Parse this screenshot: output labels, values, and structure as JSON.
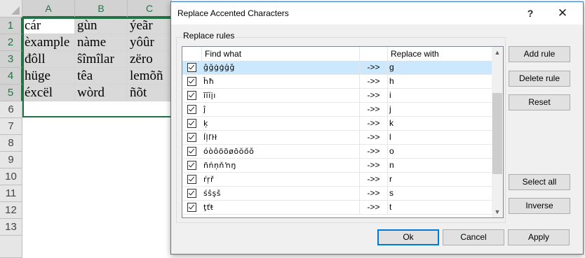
{
  "spreadsheet": {
    "columns": [
      "A",
      "B",
      "C"
    ],
    "rows": [
      "1",
      "2",
      "3",
      "4",
      "5",
      "6",
      "7",
      "8",
      "9",
      "10",
      "11",
      "12",
      "13"
    ],
    "cells": [
      [
        "cár",
        "gùn",
        "ýeãr"
      ],
      [
        "èxample",
        "nàme",
        "yôûr"
      ],
      [
        "đôll",
        "ŝîmîlar",
        "zëro"
      ],
      [
        "hüge",
        "têa",
        "lemõñ"
      ],
      [
        "éxcël",
        "wòrd",
        "ñõt"
      ]
    ]
  },
  "dialog": {
    "title": "Replace Accented Characters",
    "help_label": "?",
    "close_label": "✕",
    "group_label": "Replace rules",
    "columns": {
      "find": "Find what",
      "replace": "Replace with"
    },
    "rules": [
      {
        "find": "ĝğġģǵǧ",
        "arrow": "->>",
        "replace": "g"
      },
      {
        "find": "ĥħ",
        "arrow": "->>",
        "replace": "h"
      },
      {
        "find": "ĩīĭįı",
        "arrow": "->>",
        "replace": "i"
      },
      {
        "find": "ĵ",
        "arrow": "->>",
        "replace": "j"
      },
      {
        "find": "ķ",
        "arrow": "->>",
        "replace": "k"
      },
      {
        "find": "ĺļľŀł",
        "arrow": "->>",
        "replace": "l"
      },
      {
        "find": "óòôöõøōŏőǒ",
        "arrow": "->>",
        "replace": "o"
      },
      {
        "find": "ñńņňŉŋ",
        "arrow": "->>",
        "replace": "n"
      },
      {
        "find": "ŕŗř",
        "arrow": "->>",
        "replace": "r"
      },
      {
        "find": "śŝşš",
        "arrow": "->>",
        "replace": "s"
      },
      {
        "find": "ţťŧ",
        "arrow": "->>",
        "replace": "t"
      }
    ],
    "buttons": {
      "add_rule": "Add rule",
      "delete_rule": "Delete rule",
      "reset": "Reset",
      "select_all": "Select all",
      "inverse": "Inverse",
      "ok": "Ok",
      "cancel": "Cancel",
      "apply": "Apply"
    },
    "scroll_up_icon": "▲",
    "scroll_down_icon": "▼"
  },
  "colors": {
    "excel_green": "#217346",
    "selected_row": "#cce8ff",
    "default_button_border": "#0078d7"
  }
}
